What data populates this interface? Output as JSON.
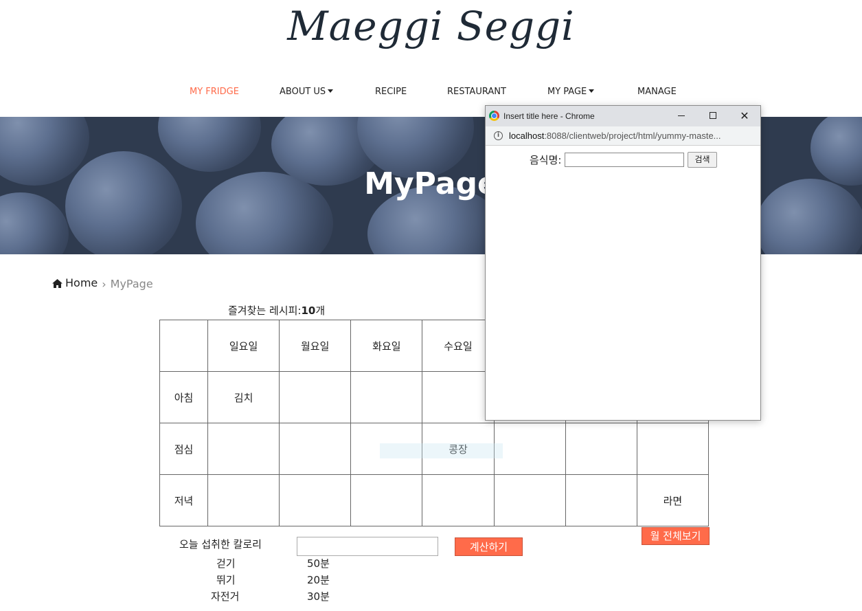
{
  "logo": "Maeggi Seggi",
  "nav": {
    "items": [
      {
        "label": "MY FRIDGE"
      },
      {
        "label": "ABOUT US"
      },
      {
        "label": "RECIPE"
      },
      {
        "label": "RESTAURANT"
      },
      {
        "label": "MY PAGE"
      },
      {
        "label": "MANAGE"
      }
    ],
    "active_color": "#ff6b4a"
  },
  "hero": {
    "title": "MyPage"
  },
  "breadcrumb": {
    "home": "Home",
    "current": "MyPage"
  },
  "favorites": {
    "label": "즐겨찾는 레시피:",
    "count": "10",
    "unit": "개"
  },
  "meal_plan": {
    "days": [
      "일요일",
      "월요일",
      "화요일",
      "수요일",
      "",
      "",
      ""
    ],
    "rows": [
      {
        "meal": "아침",
        "cells": [
          "김치",
          "",
          "",
          "",
          "",
          "",
          ""
        ]
      },
      {
        "meal": "점심",
        "cells": [
          "",
          "",
          "",
          "콩장",
          "",
          "",
          ""
        ]
      },
      {
        "meal": "저녁",
        "cells": [
          "",
          "",
          "",
          "",
          "",
          "",
          "라면"
        ]
      }
    ]
  },
  "calories": {
    "label": "오늘 섭취한 칼로리",
    "value": "",
    "calc_button": "계산하기"
  },
  "month_button": "월 전체보기",
  "exercise": [
    {
      "name": "걷기",
      "time": "50분"
    },
    {
      "name": "뛰기",
      "time": "20분"
    },
    {
      "name": "자전거",
      "time": "30분"
    }
  ],
  "popup": {
    "title": "Insert title here - Chrome",
    "url_host": "localhost",
    "url_rest": ":8088/clientweb/project/html/yummy-maste...",
    "food_label": "음식명:",
    "food_value": "",
    "search_button": "검색"
  },
  "colors": {
    "accent": "#ff6b4a",
    "logo": "#1f2a36"
  }
}
